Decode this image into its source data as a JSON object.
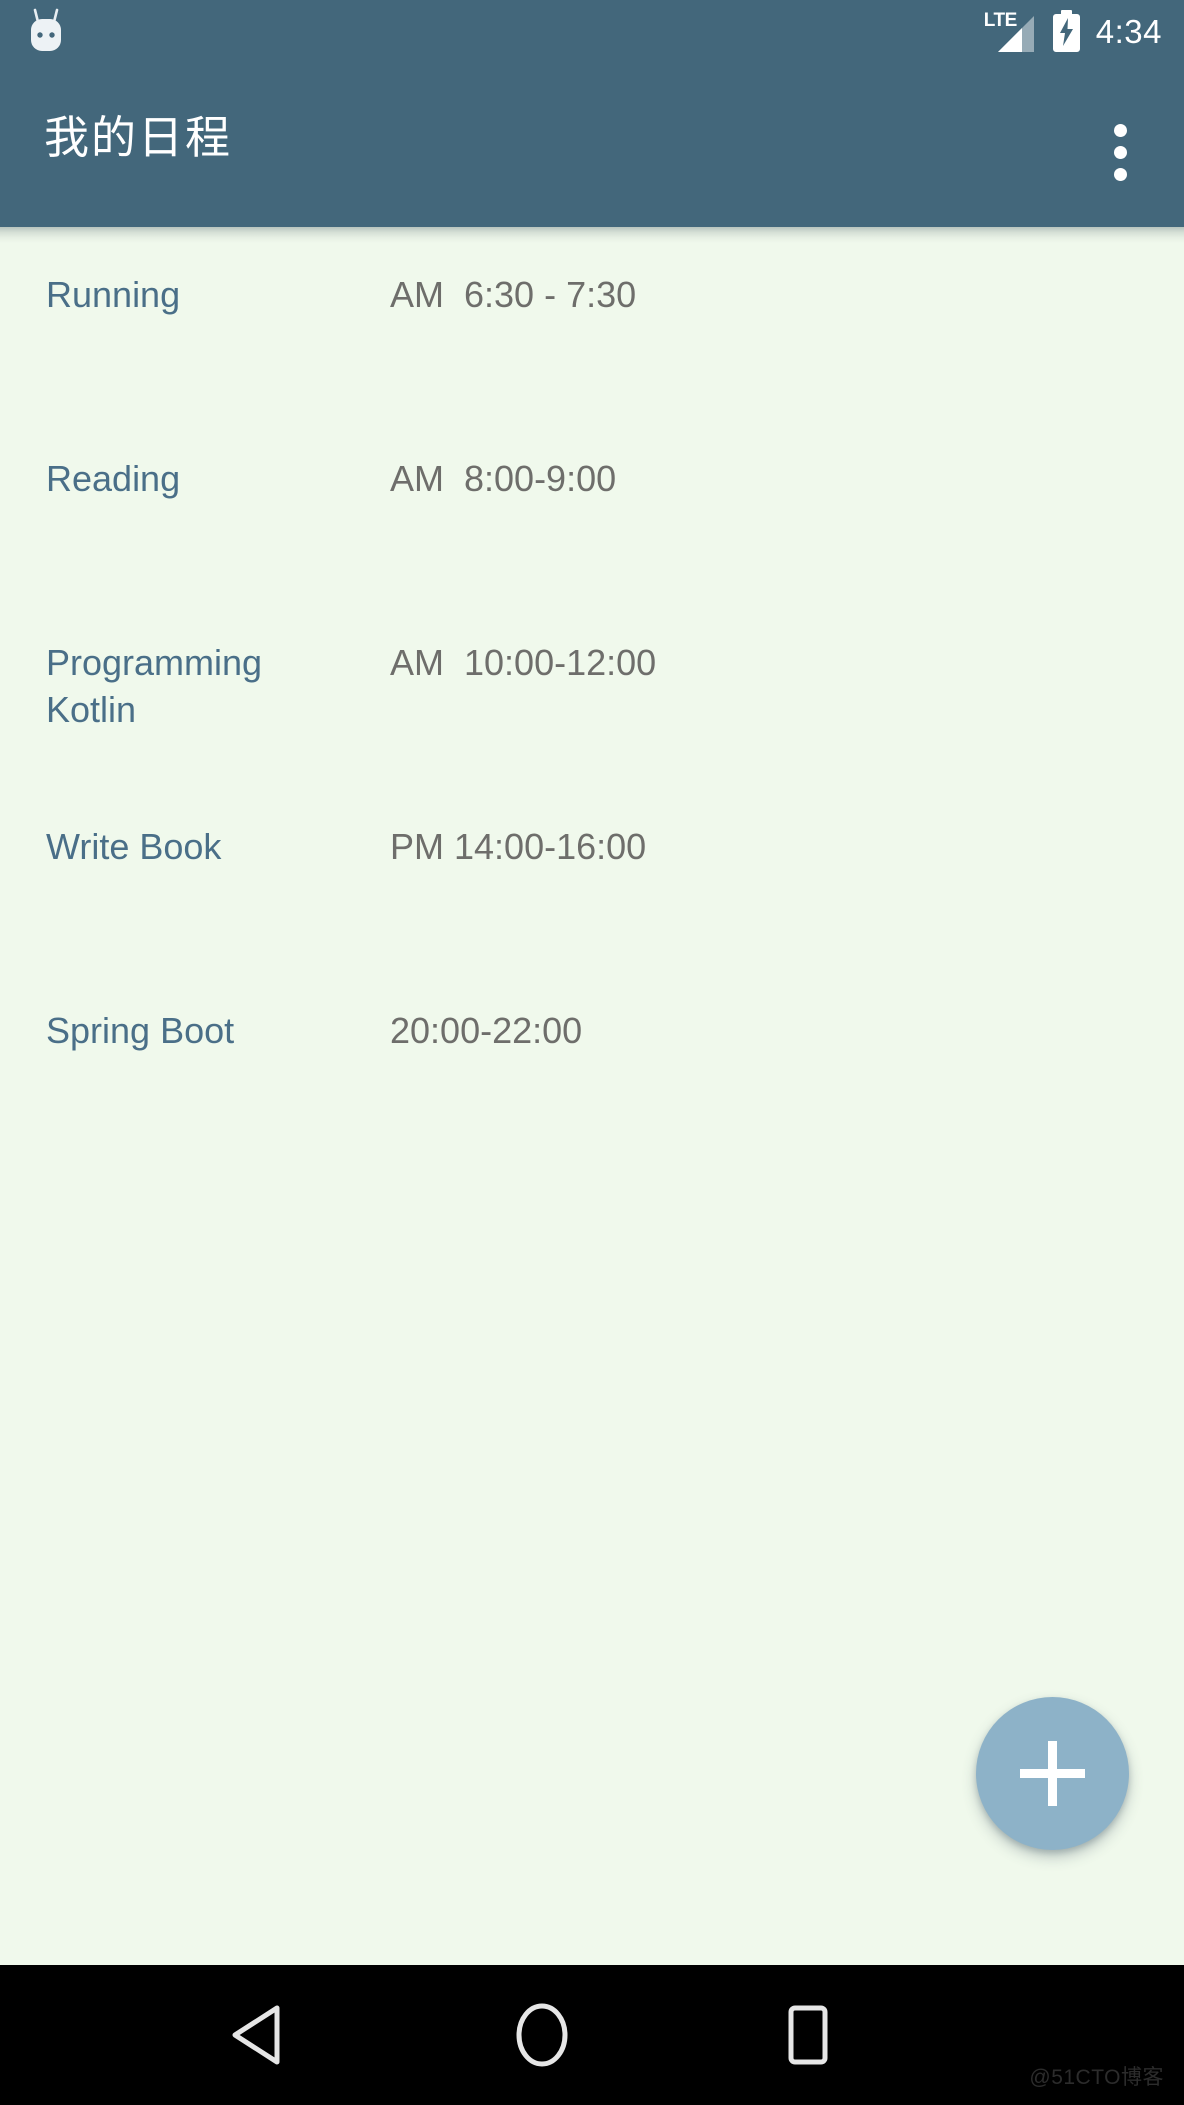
{
  "status_bar": {
    "left_icon": "android-head-icon",
    "network_label": "LTE",
    "signal_icon": "signal-bars-icon",
    "battery_icon": "battery-charging-icon",
    "time": "4:34",
    "background_color": "#43677B"
  },
  "app_bar": {
    "title": "我的日程",
    "overflow_icon": "overflow-menu-icon",
    "background_color": "#43677B",
    "title_color": "#FFFFFF"
  },
  "theme": {
    "page_background": "#F0F9EC",
    "title_text_color": "#4A6F88",
    "time_text_color": "#6E6E6B",
    "fab_color": "#8DB2C8",
    "nav_bar_color": "#000000"
  },
  "schedule": {
    "items": [
      {
        "title": "Running",
        "time": "AM  6:30 - 7:30"
      },
      {
        "title": "Reading",
        "time": "AM  8:00-9:00"
      },
      {
        "title": "Programming Kotlin",
        "time": "AM  10:00-12:00"
      },
      {
        "title": "Write Book",
        "time": "PM 14:00-16:00"
      },
      {
        "title": "Spring Boot",
        "time": "20:00-22:00"
      }
    ]
  },
  "fab": {
    "icon": "plus-icon",
    "label": "+"
  },
  "nav_bar": {
    "back_icon": "back-triangle-icon",
    "home_icon": "home-circle-icon",
    "recents_icon": "recents-square-icon"
  },
  "watermark": {
    "text": "@51CTO博客"
  }
}
